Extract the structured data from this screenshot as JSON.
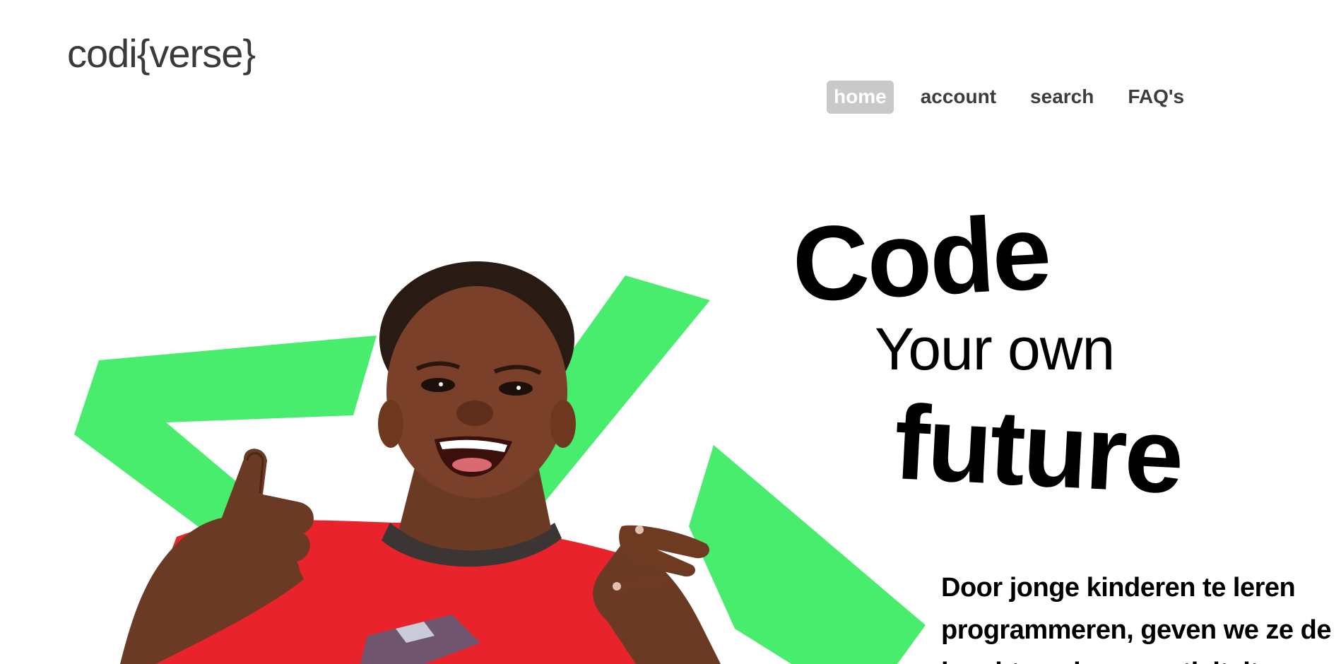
{
  "brand": {
    "logo_text": "codi{verse}"
  },
  "nav": {
    "items": [
      {
        "label": "home",
        "active": true
      },
      {
        "label": "account",
        "active": false
      },
      {
        "label": "search",
        "active": false
      },
      {
        "label": "FAQ's",
        "active": false
      }
    ]
  },
  "hero": {
    "headline_code": "Code",
    "headline_your_own": "Your own",
    "headline_future": "future",
    "intro_text": "Door jonge kinderen te leren programmeren, geven we ze de kracht om hun creativiteit",
    "image_subject": "smiling-child-thumbs-up",
    "accent_color": "#48ed6e",
    "shirt_color": "#e8232b"
  },
  "colors": {
    "background": "#ffffff",
    "text_dark": "#3a3a3a",
    "nav_active_bg": "#c9c9c9"
  }
}
